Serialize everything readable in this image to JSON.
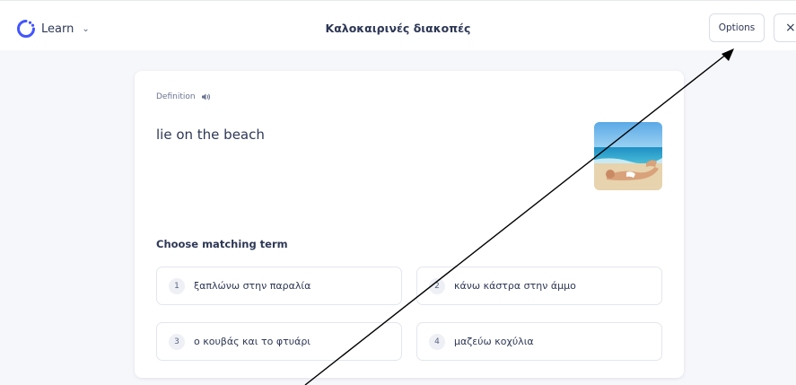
{
  "header": {
    "mode_label": "Learn",
    "set_title": "Καλοκαιρινές διακοπές",
    "options_label": "Options",
    "close_label": "×"
  },
  "card": {
    "definition_label": "Definition",
    "definition_text": "lie on the beach",
    "choose_label": "Choose matching term",
    "options": [
      {
        "number": "1",
        "text": "ξαπλώνω στην παραλία"
      },
      {
        "number": "2",
        "text": "κάνω κάστρα στην άμμο"
      },
      {
        "number": "3",
        "text": "ο κουβάς και το φτυάρι"
      },
      {
        "number": "4",
        "text": "μαζεύω κοχύλια"
      }
    ]
  },
  "icons": {
    "logo": "learn-progress-ring-icon",
    "mode_dropdown": "chevron-down-icon",
    "audio": "speaker-icon",
    "close": "close-icon"
  },
  "colors": {
    "accent": "#4255ff",
    "text": "#2e3856",
    "background": "#f6f7fb"
  }
}
